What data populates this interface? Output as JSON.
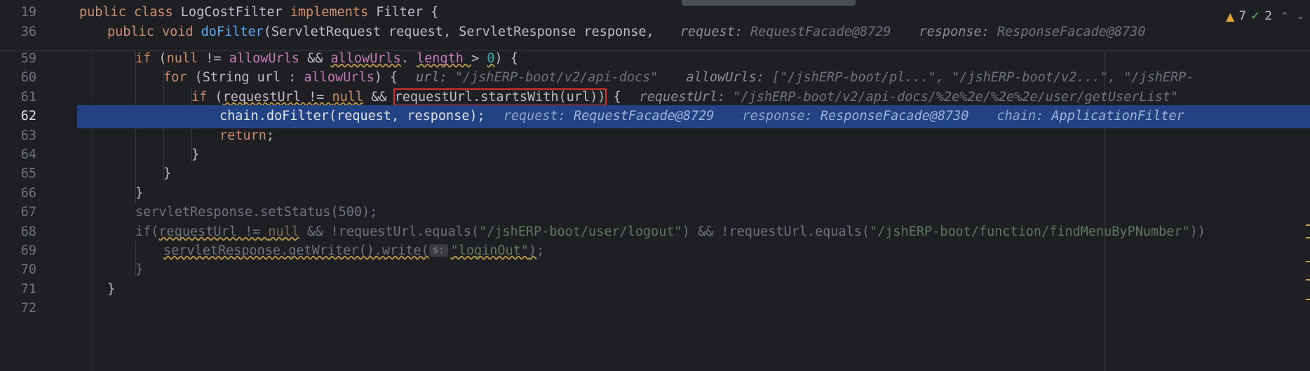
{
  "inspections": {
    "warnings": "7",
    "weak_warnings": "2"
  },
  "sticky": [
    {
      "ln": "19",
      "parts": [
        [
          "kw",
          "public class "
        ],
        [
          "",
          "LogCostFilter "
        ],
        [
          "kw",
          "implements "
        ],
        [
          "",
          "Filter {"
        ]
      ]
    },
    {
      "ln": "36",
      "parts": [
        [
          "kw",
          "public void "
        ],
        [
          "fn",
          "doFilter"
        ],
        [
          "",
          "(ServletRequest request, ServletResponse response, "
        ]
      ],
      "hints": [
        [
          "request: ",
          "RequestFacade@8729"
        ],
        [
          "response: ",
          "ResponseFacade@8730"
        ]
      ]
    }
  ],
  "lines": [
    {
      "ln": "59",
      "parts": [
        [
          "kw",
          "if "
        ],
        [
          "",
          "("
        ],
        [
          "kw",
          "null "
        ],
        [
          "",
          "!= "
        ],
        [
          "pu",
          "allowUrls "
        ],
        [
          "",
          "&& "
        ],
        [
          "pu wavy",
          "allowUrls"
        ],
        [
          "",
          ". "
        ],
        [
          "pu wavy",
          "length "
        ],
        [
          "",
          "> "
        ],
        [
          "nu wavy",
          "0"
        ],
        [
          "",
          ") {"
        ]
      ]
    },
    {
      "ln": "60",
      "parts": [
        [
          "kw",
          "for "
        ],
        [
          "",
          "(String url : "
        ],
        [
          "pu",
          "allowUrls"
        ],
        [
          "",
          ") {"
        ]
      ],
      "hints": [
        [
          "url: ",
          "\"/jshERP-boot/v2/api-docs\""
        ],
        [
          "allowUrls: ",
          "[\"/jshERP-boot/pl...\", \"/jshERP-boot/v2...\", \"/jshERP-"
        ]
      ]
    },
    {
      "ln": "61",
      "parts": [
        [
          "kw",
          "if "
        ],
        [
          "",
          "("
        ],
        [
          "wavy",
          "requestUrl != "
        ],
        [
          "kw wavy",
          "null"
        ],
        [
          "",
          " && "
        ],
        [
          "box",
          "requestUrl.startsWith(url))"
        ],
        [
          "",
          " {"
        ]
      ],
      "hints": [
        [
          "requestUrl: ",
          "\"/jshERP-boot/v2/api-docs/%2e%2e/%2e%2e/user/getUserList\""
        ]
      ]
    },
    {
      "ln": "62",
      "parts": [
        [
          "",
          "chain.doFilter(request, response);"
        ]
      ],
      "hints": [
        [
          "request: ",
          "RequestFacade@8729"
        ],
        [
          "response: ",
          "ResponseFacade@8730"
        ],
        [
          "chain: ",
          "ApplicationFilter"
        ]
      ]
    },
    {
      "ln": "63",
      "parts": [
        [
          "kw",
          "return"
        ],
        [
          "",
          ";"
        ]
      ]
    },
    {
      "ln": "64",
      "parts": [
        [
          "",
          "}"
        ]
      ]
    },
    {
      "ln": "65",
      "parts": [
        [
          "",
          "}"
        ]
      ]
    },
    {
      "ln": "66",
      "parts": [
        [
          "",
          "}"
        ]
      ]
    },
    {
      "ln": "67",
      "parts": [
        [
          "",
          "servletResponse.setStatus(500);"
        ]
      ]
    },
    {
      "ln": "68",
      "parts": [
        [
          "",
          "if("
        ],
        [
          "wavy",
          "requestUrl != "
        ],
        [
          "kw wavy",
          "null"
        ],
        [
          "",
          " && !requestUrl.equals("
        ],
        [
          "st",
          "\"/jshERP-boot/user/logout\""
        ],
        [
          "",
          ") && !requestUrl.equals("
        ],
        [
          "st",
          "\"/jshERP-boot/function/findMenuByPNumber\""
        ],
        [
          "",
          "))"
        ]
      ]
    },
    {
      "ln": "69",
      "parts": [
        [
          "wavy",
          "servletResponse.getWriter().write("
        ],
        [
          "param",
          "s:"
        ],
        [
          "st wavy",
          "\"loginOut\""
        ],
        [
          "wavy",
          ")"
        ],
        [
          "",
          ";"
        ]
      ]
    },
    {
      "ln": "70",
      "parts": [
        [
          "",
          "}"
        ]
      ]
    },
    {
      "ln": "71",
      "parts": [
        [
          "",
          "}"
        ]
      ]
    },
    {
      "ln": "72",
      "parts": []
    }
  ]
}
